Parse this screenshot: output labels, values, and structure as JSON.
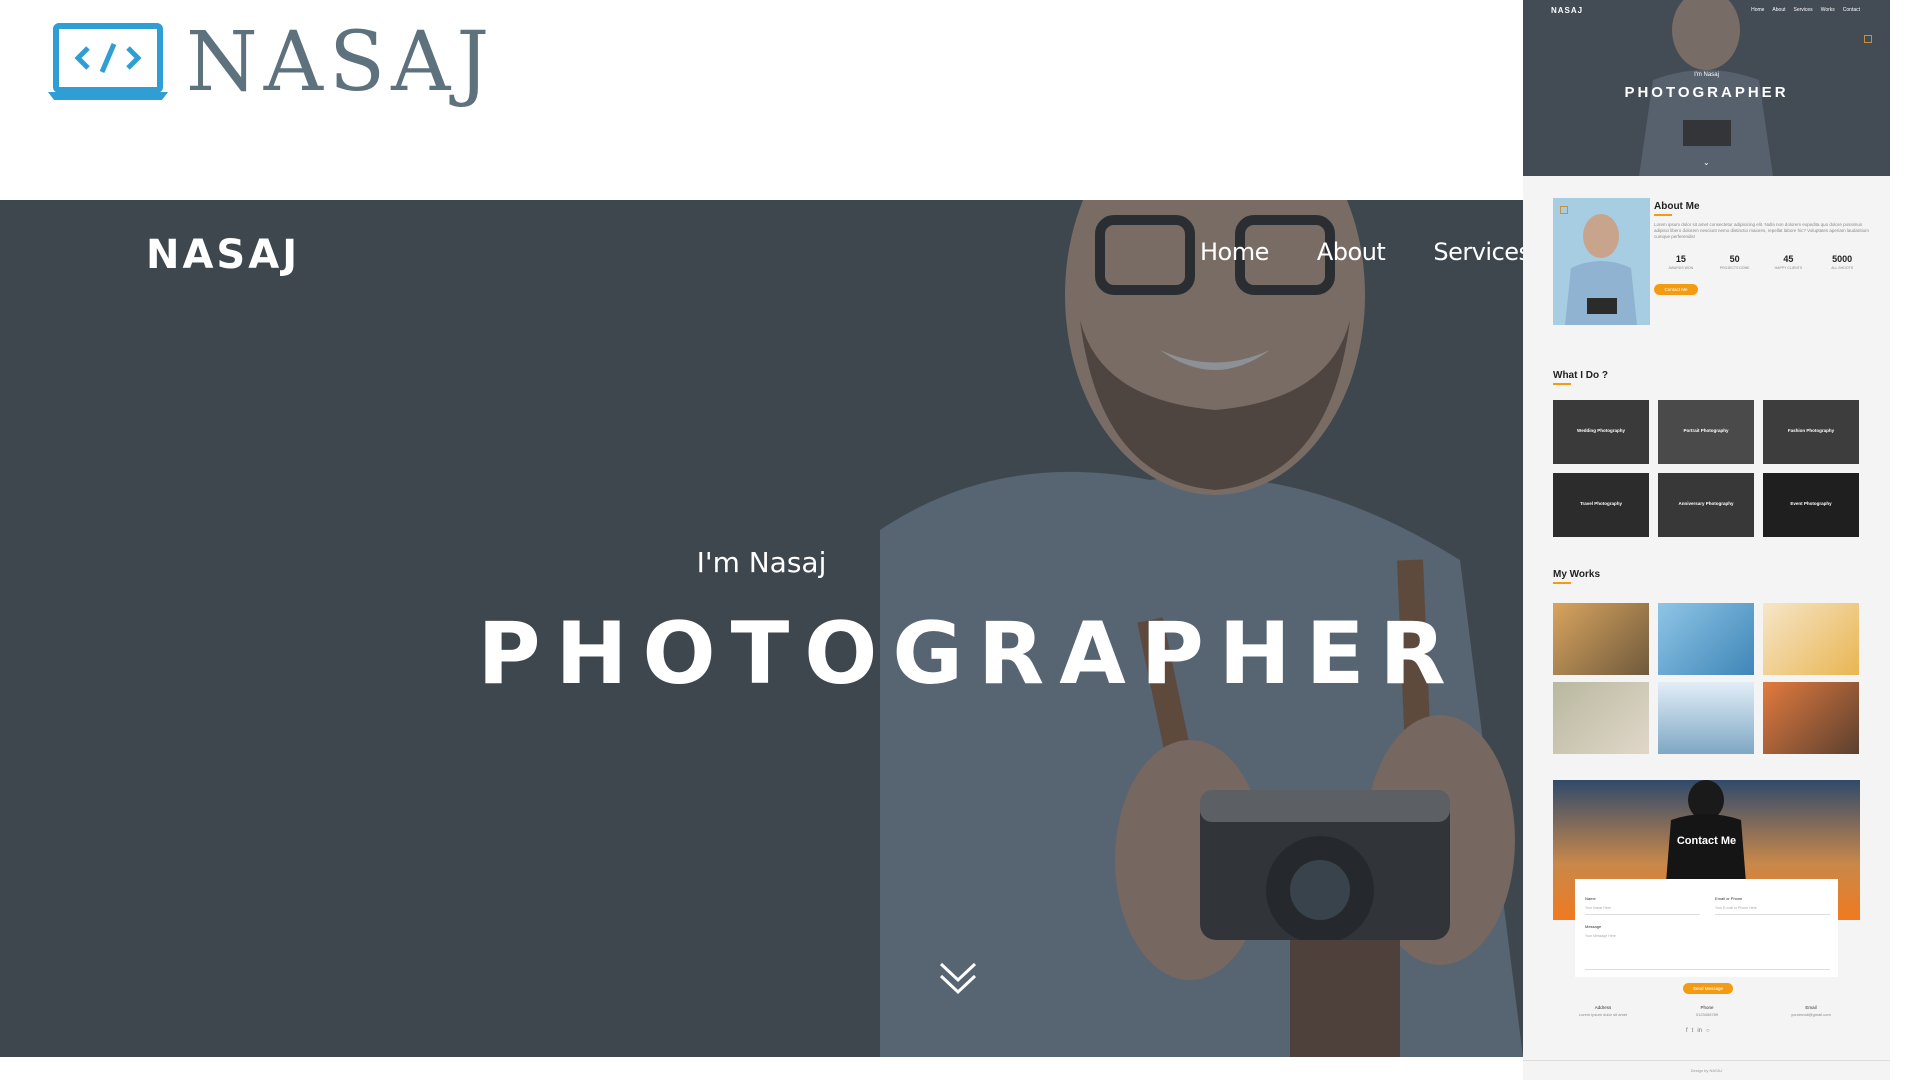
{
  "brand": {
    "name": "NASAJ",
    "icon": "laptop-code-icon",
    "color": "#5d727c",
    "icon_color": "#2e9ed4"
  },
  "hero": {
    "logo": "NASAJ",
    "nav": [
      "Home",
      "About",
      "Services"
    ],
    "intro": "I'm Nasaj",
    "title": "PHOTOGRAPHER",
    "scroll_icon": "double-chevron-down-icon"
  },
  "preview": {
    "logo": "NASAJ",
    "nav": [
      "Home",
      "About",
      "Services",
      "Works",
      "Contact"
    ],
    "intro": "I'm Nasaj",
    "title": "PHOTOGRAPHER",
    "about": {
      "title": "About Me",
      "text": "Lorem ipsum dolor sit amet consectetur adipisicing elit. Nulla non dolorem expedita quo dolore possimus adipisci libero dolorem nesciunt nemo distinctio maiores, repellat labore hic? Voluptates aperiam laudantium cumque perferendis!",
      "stats": [
        {
          "value": "15",
          "label": "AWARDS WON"
        },
        {
          "value": "50",
          "label": "PROJECTS DONE"
        },
        {
          "value": "45",
          "label": "HAPPY CLIENTS"
        },
        {
          "value": "5000",
          "label": "ALL SHOOTS"
        }
      ],
      "button": "Contact Me"
    },
    "services": {
      "title": "What I Do ?",
      "items": [
        "Wedding Photography",
        "Portrait Photography",
        "Fashion Photography",
        "Travel Photography",
        "Anniversary Photography",
        "Event Photography"
      ]
    },
    "works": {
      "title": "My Works"
    },
    "contact": {
      "title": "Contact Me",
      "name_label": "Name",
      "name_placeholder": "Your Name Here",
      "email_label": "Email or Phone",
      "email_placeholder": "Your E-mail or Phone Here",
      "message_label": "Message",
      "message_placeholder": "Your Message Here",
      "button": "Send Message",
      "info": [
        {
          "label": "Address",
          "value": "Lorem ipsum dolor sit amet"
        },
        {
          "label": "Phone",
          "value": "0123456789"
        },
        {
          "label": "Email",
          "value": "youremail@gmail.com"
        }
      ],
      "social": [
        "facebook-icon",
        "twitter-icon",
        "linkedin-icon",
        "instagram-icon"
      ]
    },
    "footer": "Design by NASAJ"
  },
  "colors": {
    "accent": "#f39c12",
    "hero_bg": "#3e464e"
  }
}
